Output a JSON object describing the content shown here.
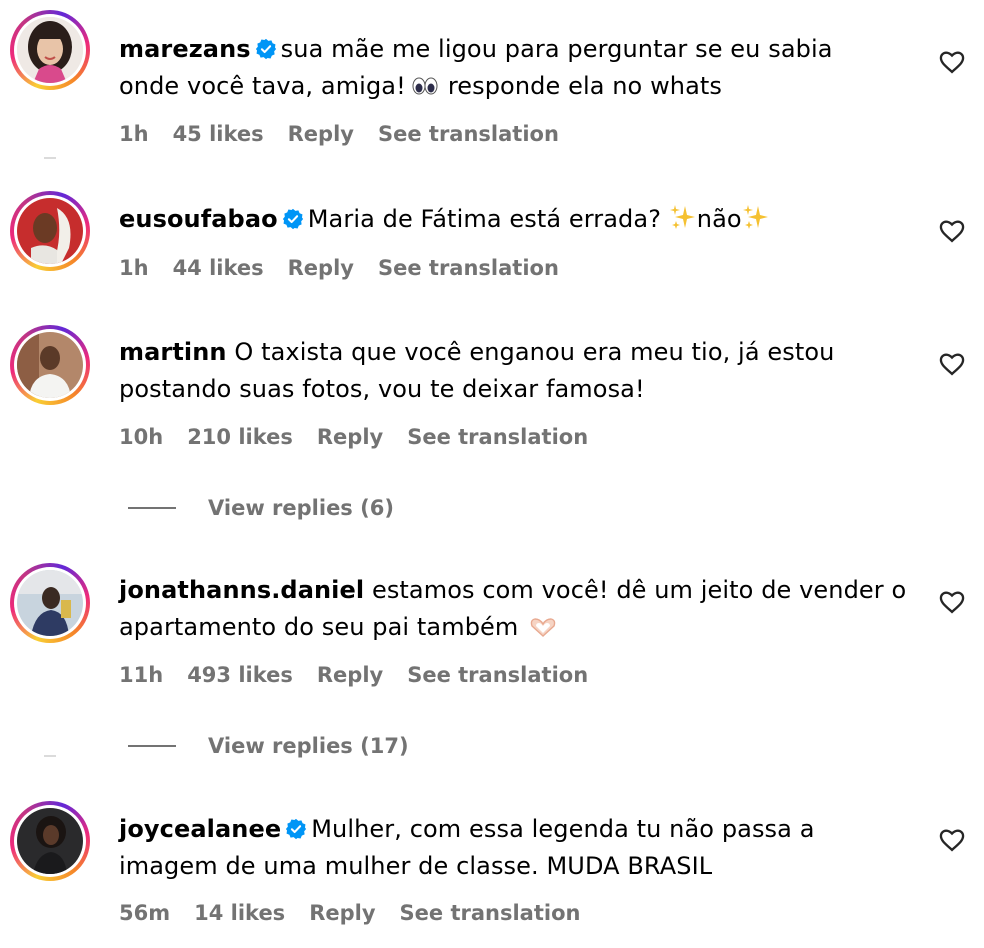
{
  "comments": [
    {
      "username": "marezans",
      "verified": true,
      "text_line1": "sua mãe me ligou para perguntar se eu sabia",
      "text_line2_before": "onde você tava, amiga!",
      "text_line2_after": "responde ela no whats",
      "time": "1h",
      "likes": "45 likes",
      "reply": "Reply",
      "translate": "See translation"
    },
    {
      "username": "eusoufabao",
      "verified": true,
      "text_before": "Maria de Fátima está errada?",
      "text_middle": "não",
      "time": "1h",
      "likes": "44 likes",
      "reply": "Reply",
      "translate": "See translation"
    },
    {
      "username": "martinn",
      "verified": false,
      "text_line1": "O taxista que você enganou era meu tio, já estou",
      "text_line2": "postando suas fotos, vou te deixar famosa!",
      "time": "10h",
      "likes": "210 likes",
      "reply": "Reply",
      "translate": "See translation",
      "view_replies": "View replies (6)"
    },
    {
      "username": "jonathanns.daniel",
      "verified": false,
      "text_line1": "estamos com você! dê um jeito de vender o",
      "text_line2": "apartamento do seu pai também",
      "time": "11h",
      "likes": "493 likes",
      "reply": "Reply",
      "translate": "See translation",
      "view_replies": "View replies (17)"
    },
    {
      "username": "joycealanee",
      "verified": true,
      "text_line1": "Mulher, com essa legenda tu não passa a",
      "text_line2": "imagem de uma mulher de classe. MUDA BRASIL",
      "time": "56m",
      "likes": "14 likes",
      "reply": "Reply",
      "translate": "See translation"
    }
  ],
  "icons": {
    "verified": "verified-badge-icon",
    "like": "heart-outline-icon"
  },
  "colors": {
    "verified_blue": "#0095f6",
    "meta_gray": "#737373"
  }
}
